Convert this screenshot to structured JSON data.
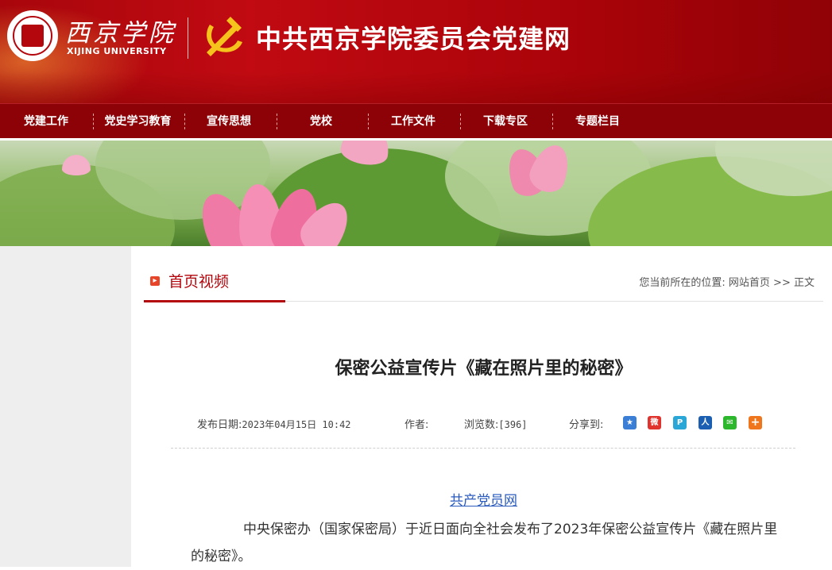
{
  "header": {
    "school_name_cn": "西京学院",
    "school_name_en": "XIJING UNIVERSITY",
    "site_title": "中共西京学院委员会党建网",
    "logo_icon": "xijing-university-seal",
    "emblem_icon": "hammer-sickle-emblem",
    "colors": {
      "primary": "#b3060d",
      "nav": "#8d0207",
      "gold": "#f5c31c"
    }
  },
  "nav": {
    "items": [
      {
        "label": "党建工作"
      },
      {
        "label": "党史学习教育"
      },
      {
        "label": "宣传思想"
      },
      {
        "label": "党校"
      },
      {
        "label": "工作文件"
      },
      {
        "label": "下载专区"
      },
      {
        "label": "专题栏目"
      }
    ]
  },
  "section": {
    "marker_icon": "arrow-right-square-icon",
    "title": "首页视频",
    "breadcrumb_prefix": "您当前所在的位置:",
    "breadcrumb_home": "网站首页",
    "breadcrumb_sep": ">>",
    "breadcrumb_current": "正文"
  },
  "article": {
    "title": "保密公益宣传片《藏在照片里的秘密》",
    "date_label": "发布日期:",
    "date_value": "2023年04月15日 10:42",
    "author_label": "作者:",
    "views_label": "浏览数:",
    "views_value": "[396]",
    "share_label": "分享到:",
    "share_icons": [
      {
        "name": "qzone-share-icon",
        "glyph": "★",
        "color": "#3a7fd5"
      },
      {
        "name": "weibo-share-icon",
        "glyph": "微",
        "color": "#e0332d"
      },
      {
        "name": "tencent-weibo-share-icon",
        "glyph": "P",
        "color": "#2aa7d6"
      },
      {
        "name": "renren-share-icon",
        "glyph": "人",
        "color": "#1b5fb3"
      },
      {
        "name": "wechat-share-icon",
        "glyph": "✉",
        "color": "#2cb72c"
      },
      {
        "name": "more-share-icon",
        "glyph": "+",
        "color": "#f0761e"
      }
    ],
    "source": "共产党员网",
    "paragraph": "中央保密办（国家保密局）于近日面向全社会发布了2023年保密公益宣传片《藏在照片里的秘密》。"
  }
}
